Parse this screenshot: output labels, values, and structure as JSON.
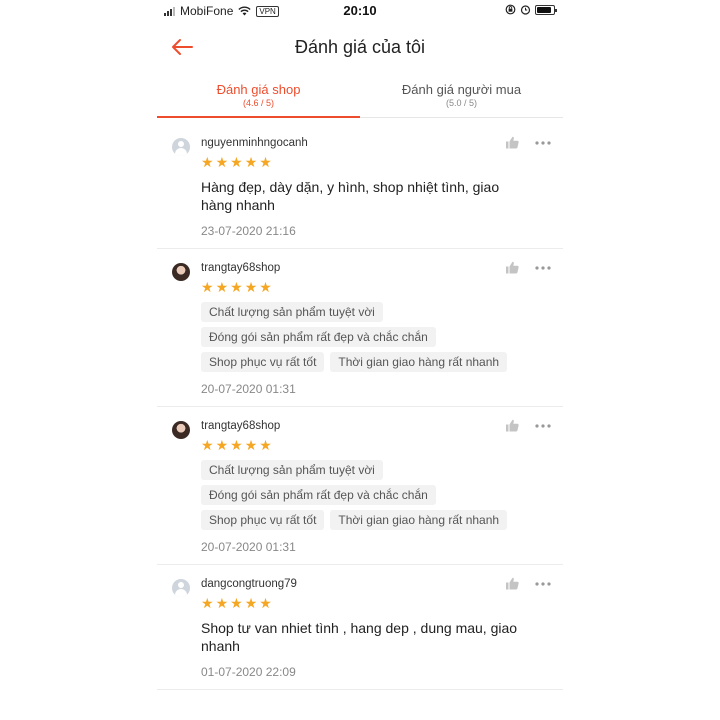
{
  "status_bar": {
    "carrier": "MobiFone",
    "vpn_label": "VPN",
    "time": "20:10"
  },
  "header": {
    "title": "Đánh giá của tôi"
  },
  "tabs": [
    {
      "label": "Đánh giá shop",
      "sub": "(4.6 / 5)",
      "active": true
    },
    {
      "label": "Đánh giá người mua",
      "sub": "(5.0 / 5)",
      "active": false
    }
  ],
  "reviews": [
    {
      "username": "nguyenminhngocanh",
      "stars": 5,
      "comment": "Hàng đẹp,  dày dặn,  y hình,  shop nhiệt tình,  giao hàng nhanh",
      "tags": [],
      "date": "23-07-2020 21:16"
    },
    {
      "username": "trangtay68shop",
      "stars": 5,
      "comment": "",
      "tags": [
        "Chất lượng sản phẩm tuyệt vời",
        "Đóng gói sản phẩm rất đẹp và chắc chắn",
        "Shop phục vụ rất tốt",
        "Thời gian giao hàng rất nhanh"
      ],
      "date": "20-07-2020 01:31"
    },
    {
      "username": "trangtay68shop",
      "stars": 5,
      "comment": "",
      "tags": [
        "Chất lượng sản phẩm tuyệt vời",
        "Đóng gói sản phẩm rất đẹp và chắc chắn",
        "Shop phục vụ rất tốt",
        "Thời gian giao hàng rất nhanh"
      ],
      "date": "20-07-2020 01:31"
    },
    {
      "username": "dangcongtruong79",
      "stars": 5,
      "comment": "Shop tư van nhiet tình , hang dep , dung mau, giao nhanh",
      "tags": [],
      "date": "01-07-2020 22:09"
    }
  ],
  "colors": {
    "accent": "#ee4d2d",
    "star": "#f5a623"
  },
  "icons": {
    "back": "arrow-left-icon",
    "like": "thumbs-up-icon",
    "more": "more-dots-icon"
  }
}
